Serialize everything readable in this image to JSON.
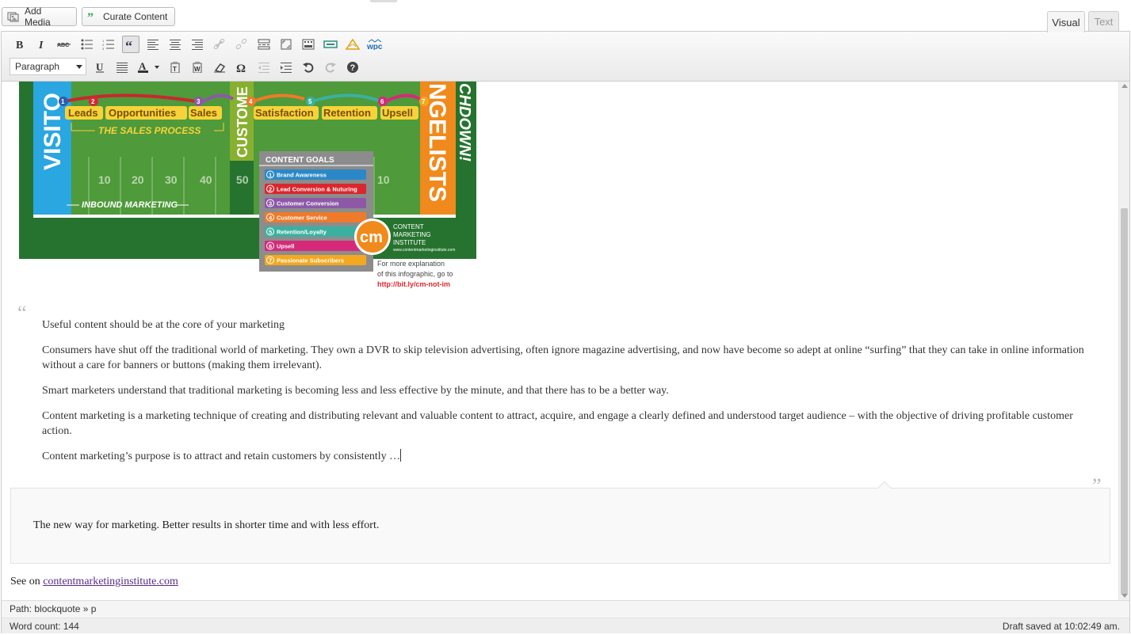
{
  "top_buttons": {
    "add_media": "Add Media",
    "curate_content": "Curate Content"
  },
  "tabs": {
    "visual": "Visual",
    "text": "Text"
  },
  "toolbar": {
    "row1_icons": [
      "bold-icon",
      "italic-icon",
      "strikethrough-icon",
      "bullet-list-icon",
      "numbered-list-icon",
      "blockquote-icon",
      "align-left-icon",
      "align-center-icon",
      "align-right-icon",
      "insert-link-icon",
      "remove-link-icon",
      "insert-more-icon",
      "fullscreen-icon",
      "toolbar-toggle-icon",
      "plugin-ticket-icon",
      "plugin-warning-icon",
      "wpc-icon"
    ],
    "format_select": "Paragraph",
    "row2_icons": [
      "underline-icon",
      "justify-icon",
      "text-color-icon",
      "paste-text-icon",
      "paste-word-icon",
      "clear-formatting-icon",
      "special-character-icon",
      "outdent-icon",
      "indent-icon",
      "undo-icon",
      "redo-icon",
      "help-icon"
    ]
  },
  "infographic": {
    "labels": [
      "Leads",
      "Opportunities",
      "Sales",
      "Satisfaction",
      "Retention",
      "Upsell"
    ],
    "sales_process": "THE SALES PROCESS",
    "inbound_marketing": "INBOUND MARKETING",
    "visitors_partial": "VISITO",
    "customers_partial": "CUSTOME",
    "evangelists_partial": "NGELISTS",
    "touchdown_partial": "CHDOWN!",
    "yard_markers": [
      "10",
      "20",
      "30",
      "40",
      "50",
      "10"
    ],
    "content_goals_title": "CONTENT GOALS",
    "content_goals": [
      {
        "n": "1",
        "label": "Brand Awareness",
        "color": "#2a88c8"
      },
      {
        "n": "2",
        "label": "Lead Conversion & Nuturing",
        "color": "#d9272e"
      },
      {
        "n": "3",
        "label": "Customer Conversion",
        "color": "#8d59a7"
      },
      {
        "n": "4",
        "label": "Customer Service",
        "color": "#ef7a2a"
      },
      {
        "n": "5",
        "label": "Retention/Loyalty",
        "color": "#3bb0a0"
      },
      {
        "n": "6",
        "label": "Upsell",
        "color": "#d6297a"
      },
      {
        "n": "7",
        "label": "Passionate Subscribers",
        "color": "#f3a81f"
      }
    ],
    "logo_text": "cm",
    "brand_lines": [
      "CONTENT",
      "MARKETING",
      "INSTITUTE"
    ],
    "brand_url": "www.contentmarketinginstitute.com",
    "explain_lines": [
      "For more explanation",
      "of this infographic, go to"
    ],
    "explain_link": "http://bit.ly/cm-not-im"
  },
  "quote": {
    "open_mark": "“",
    "close_mark": "”",
    "paragraphs": [
      "Useful content should be at the core of your marketing",
      "Consumers have shut off the traditional world of marketing. They own a DVR to skip television advertising, often ignore magazine advertising, and now have become so adept at online “surfing” that they can take in online information without a care for banners or buttons (making them irrelevant).",
      "Smart marketers understand that traditional marketing is becoming less and less effective by the minute, and that there has to be a better way.",
      "Content marketing is a marketing technique of creating and distributing relevant and valuable content to attract, acquire, and engage a clearly defined and understood target audience – with the objective of driving profitable customer action.",
      "Content marketing’s purpose is to attract and retain customers by consistently …"
    ]
  },
  "callout_text": "The new way for marketing. Better results in shorter time and with less effort.",
  "see_on": {
    "prefix": "See on",
    "link": "contentmarketinginstitute.com"
  },
  "status": {
    "path_label": "Path: blockquote » p",
    "word_count": "Word count: 144",
    "draft_saved": "Draft saved at 10:02:49 am."
  }
}
